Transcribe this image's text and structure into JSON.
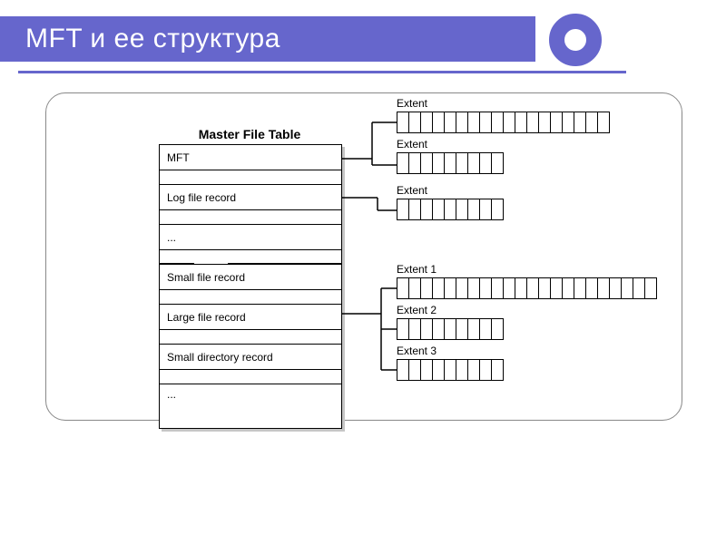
{
  "title": "MFT и ее структура",
  "diagram": {
    "table_title": "Master File Table",
    "rows": {
      "r1": "MFT",
      "r2": "Log file record",
      "r3": "...",
      "r4": "Small file record",
      "r5": "Large file record",
      "r6": "Small directory record",
      "r7": "..."
    },
    "extents": {
      "e1": "Extent",
      "e2": "Extent",
      "e3": "Extent",
      "e4": "Extent 1",
      "e5": "Extent 2",
      "e6": "Extent 3"
    }
  },
  "colors": {
    "accent": "#6666cc"
  }
}
